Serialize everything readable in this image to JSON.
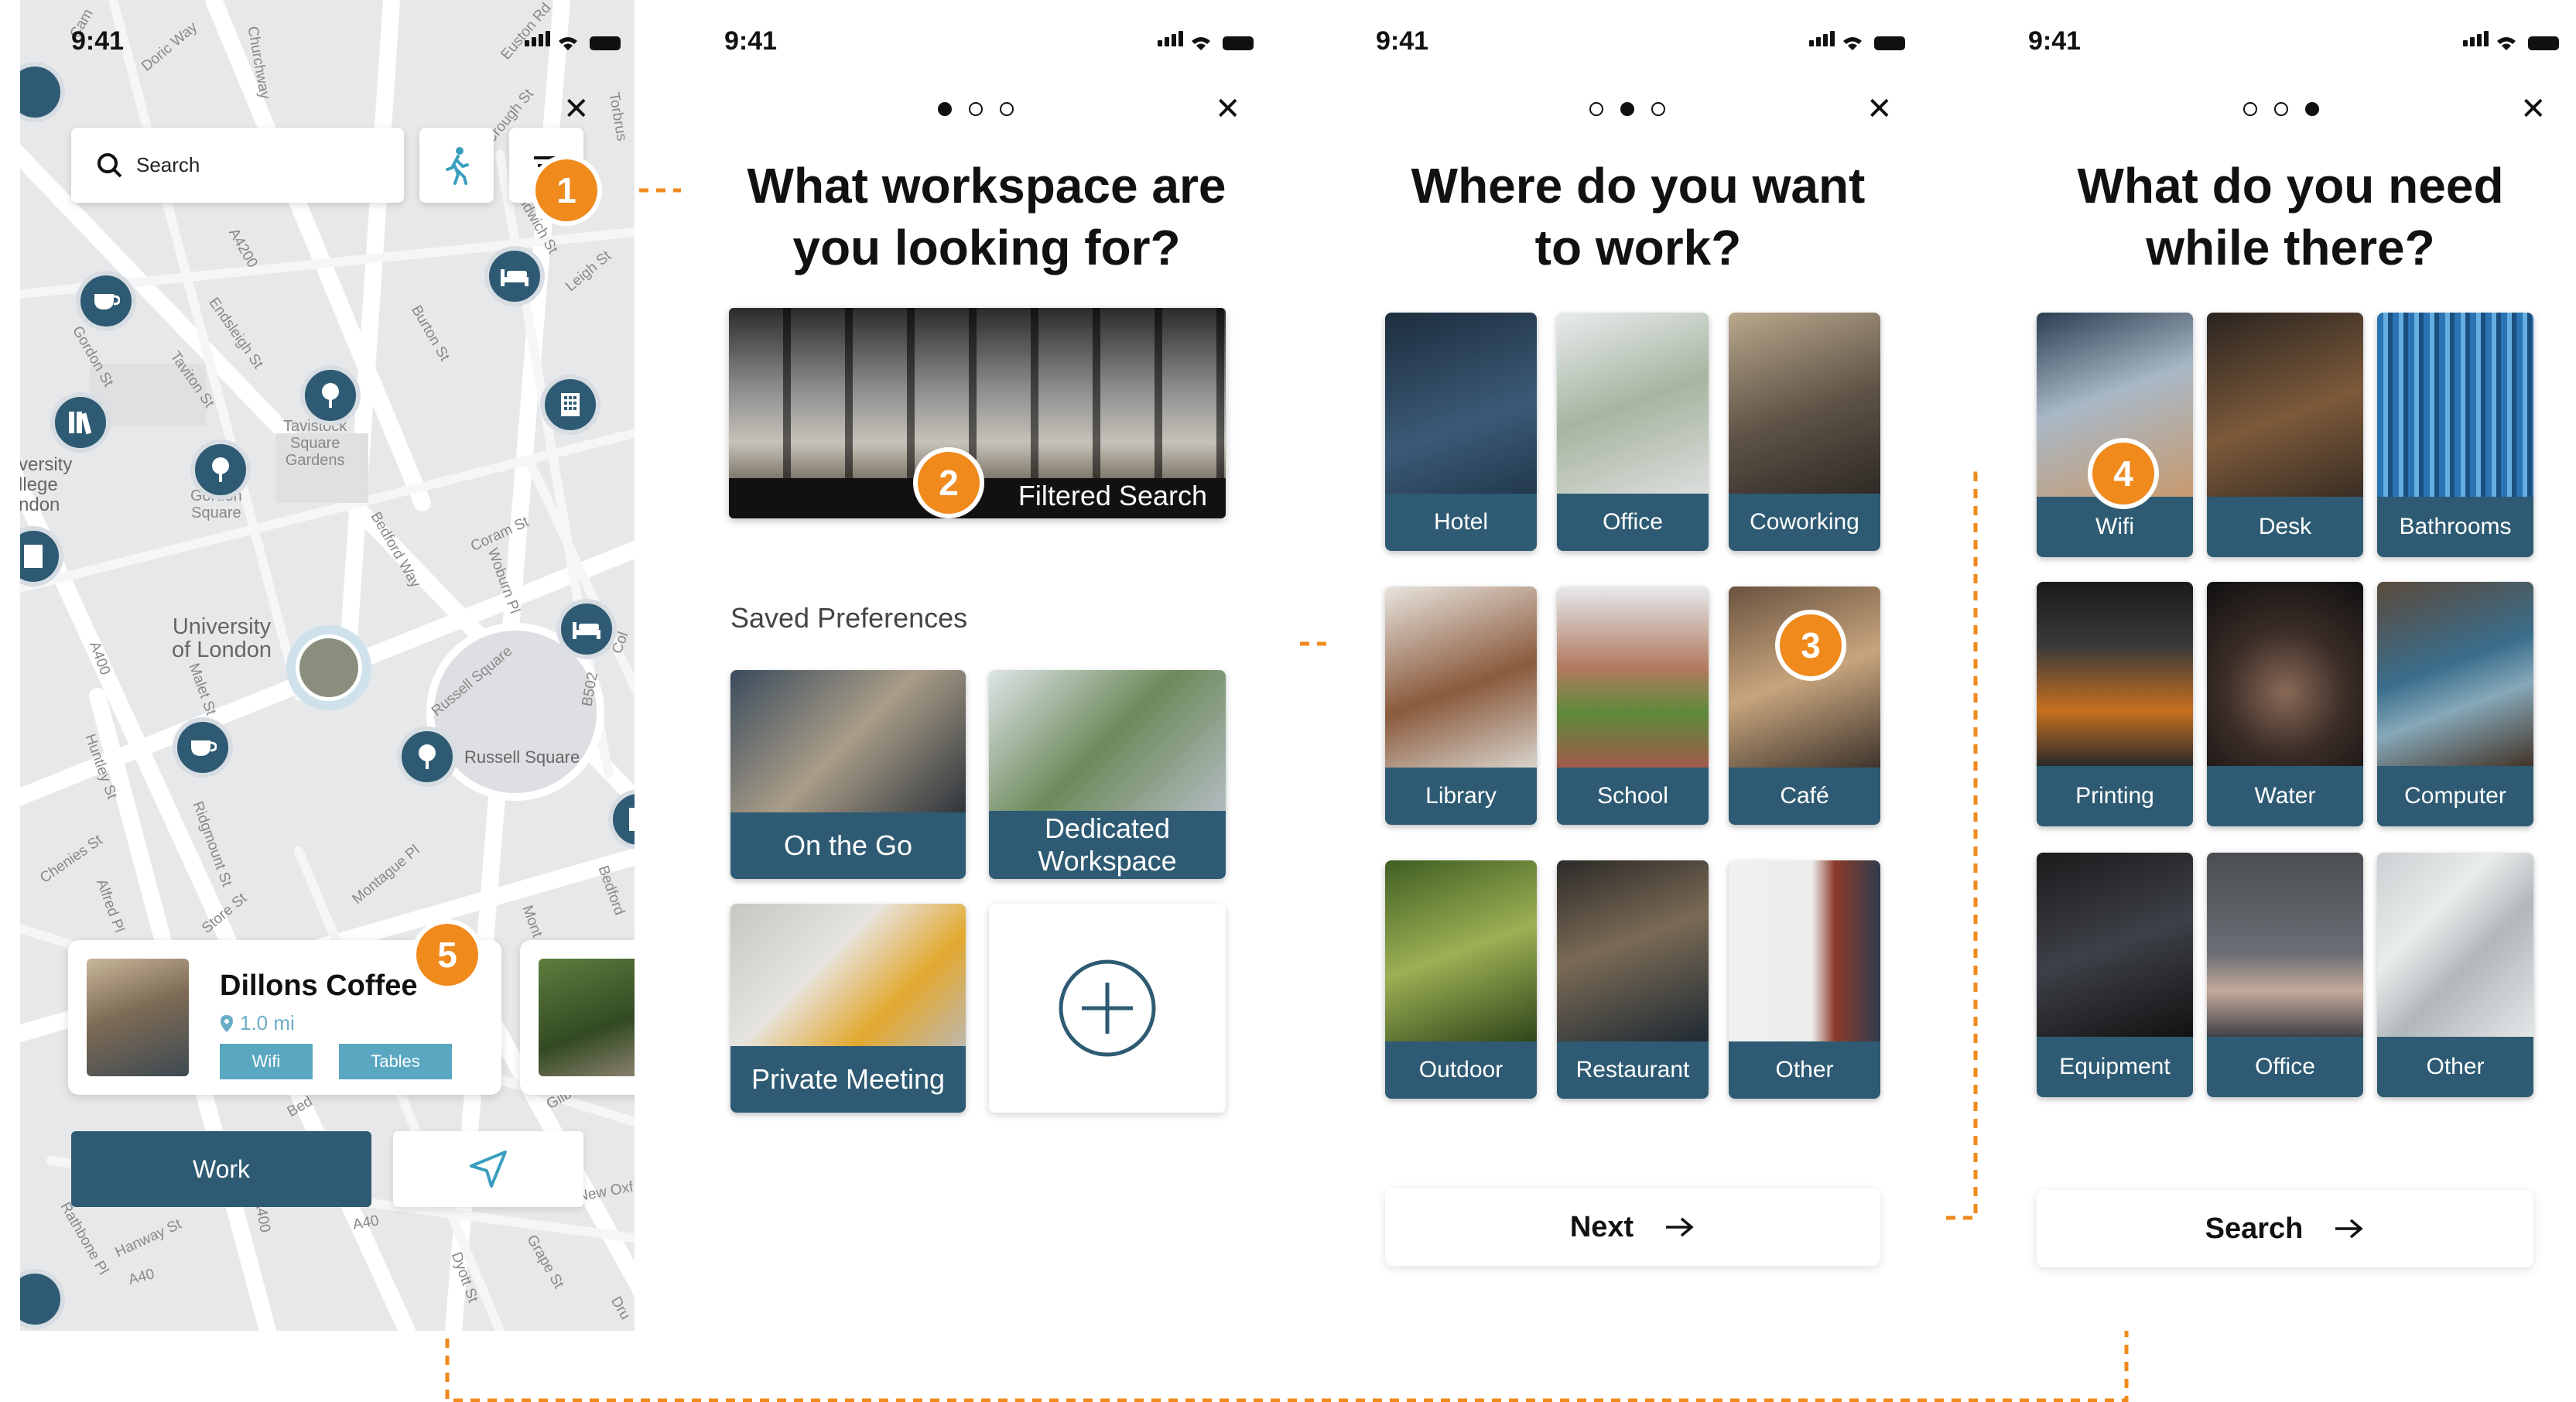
{
  "status_time": "9:41",
  "map_screen": {
    "search_placeholder": "Search",
    "place_labels": [
      "Tavistock",
      "Square",
      "Gardens",
      "University",
      "of London",
      "Gordon",
      "Square",
      "Russell Square",
      "versity",
      "llege",
      "ndon"
    ],
    "street_labels": [
      "Doric Way",
      "Churchway",
      "Euston Rd",
      "Torbrus",
      "Gordon St",
      "Endsleigh St",
      "Taviton St",
      "A4200",
      "Leigh St",
      "Burton St",
      "Coram St",
      "Woburn Pl",
      "Bedford Way",
      "A400",
      "Malet St",
      "Huntley St",
      "Chenies St",
      "Alfred Pl",
      "Ridgmount St",
      "Store St",
      "Montague Pl",
      "Bedford",
      "Russell Square",
      "B502",
      "Rathbone Pl",
      "Hanway St",
      "A40",
      "New Oxf",
      "Grape St",
      "Dyott St",
      "Dru",
      "Cam",
      "Sandwich St",
      "Crough St",
      "Col",
      "Mont",
      "A40",
      "Bed",
      "Gilb",
      "A400"
    ],
    "card": {
      "title": "Dillons Coffee",
      "distance": "1.0 mi",
      "tags": [
        "Wifi",
        "Tables"
      ]
    },
    "work_button": "Work"
  },
  "screen2": {
    "title_line1": "What workspace are",
    "title_line2": "you looking for?",
    "hero_label": "Filtered Search",
    "saved_heading": "Saved Preferences",
    "preferences": [
      "On the Go",
      "Dedicated Workspace",
      "Private Meeting"
    ],
    "dedicated_line1": "Dedicated",
    "dedicated_line2": "Workspace"
  },
  "screen3": {
    "title_line1": "Where do you want",
    "title_line2": "to work?",
    "categories": [
      "Hotel",
      "Office",
      "Coworking",
      "Library",
      "School",
      "Café",
      "Outdoor",
      "Restaurant",
      "Other"
    ],
    "next_label": "Next"
  },
  "screen4": {
    "title_line1": "What do you need",
    "title_line2": "while there?",
    "amenities": [
      "Wifi",
      "Desk",
      "Bathrooms",
      "Printing",
      "Water",
      "Computer",
      "Equipment",
      "Office",
      "Other"
    ],
    "search_label": "Search"
  },
  "steps": [
    "1",
    "2",
    "3",
    "4",
    "5"
  ],
  "colors": {
    "brand_teal": "#2e5b73",
    "accent_orange": "#f08a1c",
    "tag_blue": "#5aa7c2"
  }
}
